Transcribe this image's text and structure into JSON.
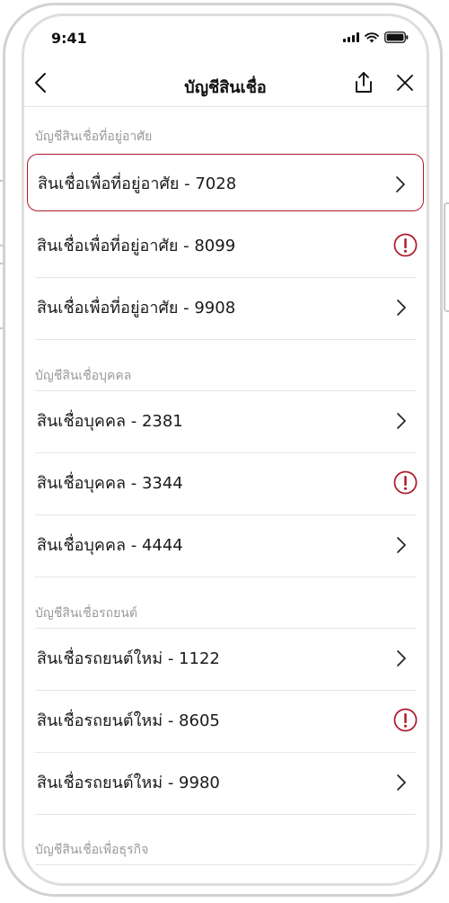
{
  "status": {
    "time": "9:41",
    "icons": [
      "signal-icon",
      "wifi-icon",
      "battery-icon"
    ]
  },
  "nav": {
    "title": "บัญชีสินเชื่อ",
    "back_icon": "chevron-left-icon",
    "share_icon": "share-icon",
    "close_icon": "close-icon"
  },
  "colors": {
    "accent": "#b01a2a",
    "alert": "#b01a2a",
    "section_text": "#9a9a9a",
    "divider": "#e6e6e6"
  },
  "sections": [
    {
      "header": "บัญชีสินเชื่อที่อยู่อาศัย",
      "items": [
        {
          "label": "สินเชื่อเพื่อที่อยู่อาศัย - 7028",
          "status": "chevron",
          "selected": true
        },
        {
          "label": "สินเชื่อเพื่อที่อยู่อาศัย - 8099",
          "status": "alert",
          "selected": false
        },
        {
          "label": "สินเชื่อเพื่อที่อยู่อาศัย - 9908",
          "status": "chevron",
          "selected": false
        }
      ]
    },
    {
      "header": "บัญชีสินเชื่อบุคคล",
      "items": [
        {
          "label": "สินเชื่อบุคคล - 2381",
          "status": "chevron",
          "selected": false
        },
        {
          "label": "สินเชื่อบุคคล - 3344",
          "status": "alert",
          "selected": false
        },
        {
          "label": "สินเชื่อบุคคล - 4444",
          "status": "chevron",
          "selected": false
        }
      ]
    },
    {
      "header": "บัญชีสินเชื่อรถยนต์",
      "items": [
        {
          "label": "สินเชื่อรถยนต์ใหม่ - 1122",
          "status": "chevron",
          "selected": false
        },
        {
          "label": "สินเชื่อรถยนต์ใหม่ - 8605",
          "status": "alert",
          "selected": false
        },
        {
          "label": "สินเชื่อรถยนต์ใหม่ - 9980",
          "status": "chevron",
          "selected": false
        }
      ]
    },
    {
      "header": "บัญชีสินเชื่อเพื่อธุรกิจ",
      "items": []
    }
  ]
}
